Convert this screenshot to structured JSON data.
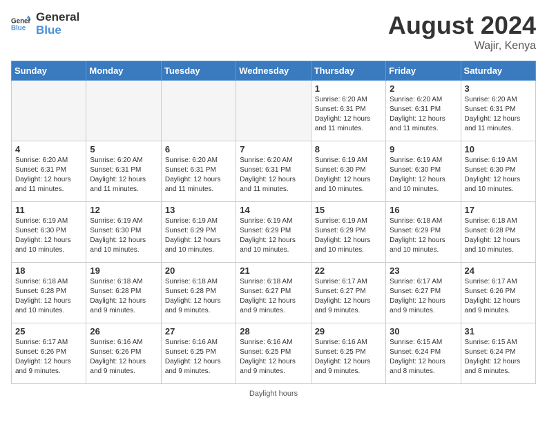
{
  "header": {
    "logo_line1": "General",
    "logo_line2": "Blue",
    "month": "August 2024",
    "location": "Wajir, Kenya"
  },
  "days_of_week": [
    "Sunday",
    "Monday",
    "Tuesday",
    "Wednesday",
    "Thursday",
    "Friday",
    "Saturday"
  ],
  "weeks": [
    [
      {
        "day": "",
        "empty": true
      },
      {
        "day": "",
        "empty": true
      },
      {
        "day": "",
        "empty": true
      },
      {
        "day": "",
        "empty": true
      },
      {
        "day": "1",
        "sunrise": "6:20 AM",
        "sunset": "6:31 PM",
        "daylight": "12 hours and 11 minutes."
      },
      {
        "day": "2",
        "sunrise": "6:20 AM",
        "sunset": "6:31 PM",
        "daylight": "12 hours and 11 minutes."
      },
      {
        "day": "3",
        "sunrise": "6:20 AM",
        "sunset": "6:31 PM",
        "daylight": "12 hours and 11 minutes."
      }
    ],
    [
      {
        "day": "4",
        "sunrise": "6:20 AM",
        "sunset": "6:31 PM",
        "daylight": "12 hours and 11 minutes."
      },
      {
        "day": "5",
        "sunrise": "6:20 AM",
        "sunset": "6:31 PM",
        "daylight": "12 hours and 11 minutes."
      },
      {
        "day": "6",
        "sunrise": "6:20 AM",
        "sunset": "6:31 PM",
        "daylight": "12 hours and 11 minutes."
      },
      {
        "day": "7",
        "sunrise": "6:20 AM",
        "sunset": "6:31 PM",
        "daylight": "12 hours and 11 minutes."
      },
      {
        "day": "8",
        "sunrise": "6:19 AM",
        "sunset": "6:30 PM",
        "daylight": "12 hours and 10 minutes."
      },
      {
        "day": "9",
        "sunrise": "6:19 AM",
        "sunset": "6:30 PM",
        "daylight": "12 hours and 10 minutes."
      },
      {
        "day": "10",
        "sunrise": "6:19 AM",
        "sunset": "6:30 PM",
        "daylight": "12 hours and 10 minutes."
      }
    ],
    [
      {
        "day": "11",
        "sunrise": "6:19 AM",
        "sunset": "6:30 PM",
        "daylight": "12 hours and 10 minutes."
      },
      {
        "day": "12",
        "sunrise": "6:19 AM",
        "sunset": "6:30 PM",
        "daylight": "12 hours and 10 minutes."
      },
      {
        "day": "13",
        "sunrise": "6:19 AM",
        "sunset": "6:29 PM",
        "daylight": "12 hours and 10 minutes."
      },
      {
        "day": "14",
        "sunrise": "6:19 AM",
        "sunset": "6:29 PM",
        "daylight": "12 hours and 10 minutes."
      },
      {
        "day": "15",
        "sunrise": "6:19 AM",
        "sunset": "6:29 PM",
        "daylight": "12 hours and 10 minutes."
      },
      {
        "day": "16",
        "sunrise": "6:18 AM",
        "sunset": "6:29 PM",
        "daylight": "12 hours and 10 minutes."
      },
      {
        "day": "17",
        "sunrise": "6:18 AM",
        "sunset": "6:28 PM",
        "daylight": "12 hours and 10 minutes."
      }
    ],
    [
      {
        "day": "18",
        "sunrise": "6:18 AM",
        "sunset": "6:28 PM",
        "daylight": "12 hours and 10 minutes."
      },
      {
        "day": "19",
        "sunrise": "6:18 AM",
        "sunset": "6:28 PM",
        "daylight": "12 hours and 9 minutes."
      },
      {
        "day": "20",
        "sunrise": "6:18 AM",
        "sunset": "6:28 PM",
        "daylight": "12 hours and 9 minutes."
      },
      {
        "day": "21",
        "sunrise": "6:18 AM",
        "sunset": "6:27 PM",
        "daylight": "12 hours and 9 minutes."
      },
      {
        "day": "22",
        "sunrise": "6:17 AM",
        "sunset": "6:27 PM",
        "daylight": "12 hours and 9 minutes."
      },
      {
        "day": "23",
        "sunrise": "6:17 AM",
        "sunset": "6:27 PM",
        "daylight": "12 hours and 9 minutes."
      },
      {
        "day": "24",
        "sunrise": "6:17 AM",
        "sunset": "6:26 PM",
        "daylight": "12 hours and 9 minutes."
      }
    ],
    [
      {
        "day": "25",
        "sunrise": "6:17 AM",
        "sunset": "6:26 PM",
        "daylight": "12 hours and 9 minutes."
      },
      {
        "day": "26",
        "sunrise": "6:16 AM",
        "sunset": "6:26 PM",
        "daylight": "12 hours and 9 minutes."
      },
      {
        "day": "27",
        "sunrise": "6:16 AM",
        "sunset": "6:25 PM",
        "daylight": "12 hours and 9 minutes."
      },
      {
        "day": "28",
        "sunrise": "6:16 AM",
        "sunset": "6:25 PM",
        "daylight": "12 hours and 9 minutes."
      },
      {
        "day": "29",
        "sunrise": "6:16 AM",
        "sunset": "6:25 PM",
        "daylight": "12 hours and 9 minutes."
      },
      {
        "day": "30",
        "sunrise": "6:15 AM",
        "sunset": "6:24 PM",
        "daylight": "12 hours and 8 minutes."
      },
      {
        "day": "31",
        "sunrise": "6:15 AM",
        "sunset": "6:24 PM",
        "daylight": "12 hours and 8 minutes."
      }
    ]
  ],
  "footer": {
    "daylight_label": "Daylight hours"
  }
}
